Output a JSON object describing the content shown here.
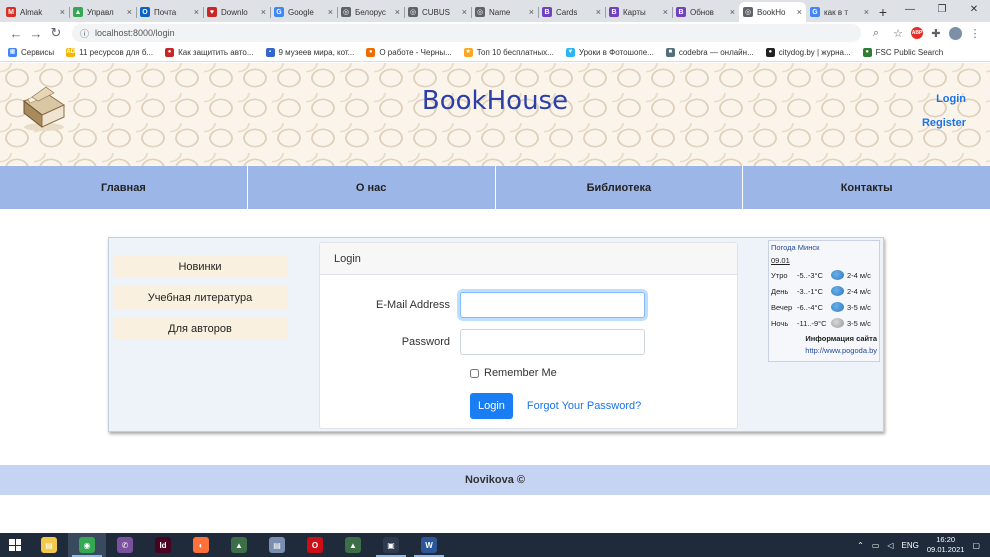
{
  "browser": {
    "tabs": [
      {
        "title": "Almak",
        "color": "#d93025",
        "glyph": "M",
        "active": false
      },
      {
        "title": "Управл",
        "color": "#34a853",
        "glyph": "▲",
        "active": false
      },
      {
        "title": "Почта",
        "color": "#0b63c4",
        "glyph": "O",
        "active": false
      },
      {
        "title": "Downlo",
        "color": "#c62828",
        "glyph": "♥",
        "active": false
      },
      {
        "title": "Google",
        "color": "#4285f4",
        "glyph": "G",
        "active": false
      },
      {
        "title": "Белорус",
        "color": "#5f6368",
        "glyph": "◎",
        "active": false
      },
      {
        "title": "CUBUS",
        "color": "#5f6368",
        "glyph": "◎",
        "active": false
      },
      {
        "title": "Name",
        "color": "#5f6368",
        "glyph": "◎",
        "active": false
      },
      {
        "title": "Cards",
        "color": "#6f42c1",
        "glyph": "B",
        "active": false
      },
      {
        "title": "Карты",
        "color": "#6f42c1",
        "glyph": "B",
        "active": false
      },
      {
        "title": "Обнов",
        "color": "#6f42c1",
        "glyph": "B",
        "active": false
      },
      {
        "title": "BookHo",
        "color": "#5f6368",
        "glyph": "◎",
        "active": true
      },
      {
        "title": "как в т",
        "color": "#4285f4",
        "glyph": "G",
        "active": false
      }
    ],
    "new_tab": "+",
    "url": "localhost:8000/login",
    "bookmarks": [
      {
        "label": "Сервисы",
        "color": "#4285f4",
        "glyph": "▦"
      },
      {
        "label": "11 ресурсов для б...",
        "color": "#f5b400",
        "glyph": "AD"
      },
      {
        "label": "Как защитить авто...",
        "color": "#c62828",
        "glyph": "●"
      },
      {
        "label": "9 музеев мира, кот...",
        "color": "#3366cc",
        "glyph": "▪"
      },
      {
        "label": "О работе - Черны...",
        "color": "#ef6c00",
        "glyph": "●"
      },
      {
        "label": "Топ 10 бесплатных...",
        "color": "#f9a825",
        "glyph": "★"
      },
      {
        "label": "Уроки в Фотошопе...",
        "color": "#29b6f6",
        "glyph": "▼"
      },
      {
        "label": "codebra — онлайн...",
        "color": "#546e7a",
        "glyph": "■"
      },
      {
        "label": "citydog.by | журна...",
        "color": "#222222",
        "glyph": "●"
      },
      {
        "label": "FSC Public Search",
        "color": "#2e7d32",
        "glyph": "●"
      }
    ]
  },
  "site": {
    "title": "BookHouse",
    "auth": {
      "login": "Login",
      "register": "Register"
    },
    "nav": [
      "Главная",
      "О нас",
      "Библиотека",
      "Контакты"
    ],
    "sidebar": [
      "Новинки",
      "Учебная литература",
      "Для авторов"
    ],
    "login_form": {
      "header": "Login",
      "email_label": "E-Mail Address",
      "email_value": "",
      "password_label": "Password",
      "password_value": "",
      "remember_label": "Remember Me",
      "remember_checked": false,
      "submit_label": "Login",
      "forgot_label": "Forgot Your Password?"
    },
    "weather": {
      "title": "Погода Минск",
      "date": "09.01",
      "rows": [
        {
          "period": "Утро",
          "temp": "-5..-3°C",
          "icon": "snow-icon",
          "wind": "2-4 м/с"
        },
        {
          "period": "День",
          "temp": "-3..-1°C",
          "icon": "snow-icon",
          "wind": "2-4 м/с"
        },
        {
          "period": "Вечер",
          "temp": "-6..-4°C",
          "icon": "snow-icon",
          "wind": "3-5 м/с"
        },
        {
          "period": "Ночь",
          "temp": "-11..-9°C",
          "icon": "cloud-icon",
          "wind": "3-5 м/с"
        }
      ],
      "info": "Информация сайта",
      "link": "http://www.pogoda.by"
    },
    "footer": "Novikova ©"
  },
  "taskbar": {
    "apps": [
      {
        "name": "file-explorer",
        "color": "#f2c94c",
        "glyph": "▤",
        "open": false,
        "active": false
      },
      {
        "name": "chrome",
        "color": "#34a853",
        "glyph": "◉",
        "open": true,
        "active": true
      },
      {
        "name": "viber",
        "color": "#7b519d",
        "glyph": "✆",
        "open": false,
        "active": false
      },
      {
        "name": "indesign",
        "color": "#49021f",
        "glyph": "Id",
        "open": false,
        "active": false
      },
      {
        "name": "firefox",
        "color": "#ff7139",
        "glyph": "◐",
        "open": false,
        "active": false
      },
      {
        "name": "photo-editor",
        "color": "#3c6e47",
        "glyph": "▲",
        "open": false,
        "active": false
      },
      {
        "name": "document-viewer",
        "color": "#7a8fb0",
        "glyph": "▤",
        "open": false,
        "active": false
      },
      {
        "name": "opera",
        "color": "#cc0f16",
        "glyph": "O",
        "open": false,
        "active": false
      },
      {
        "name": "photo-editor-2",
        "color": "#3c6e47",
        "glyph": "▲",
        "open": false,
        "active": false
      },
      {
        "name": "terminal",
        "color": "#2e3b4e",
        "glyph": "▣",
        "open": true,
        "active": false
      },
      {
        "name": "word",
        "color": "#2b579a",
        "glyph": "W",
        "open": true,
        "active": false
      }
    ],
    "tray": {
      "lang": "ENG",
      "time": "16:20",
      "date": "09.01.2021"
    }
  }
}
